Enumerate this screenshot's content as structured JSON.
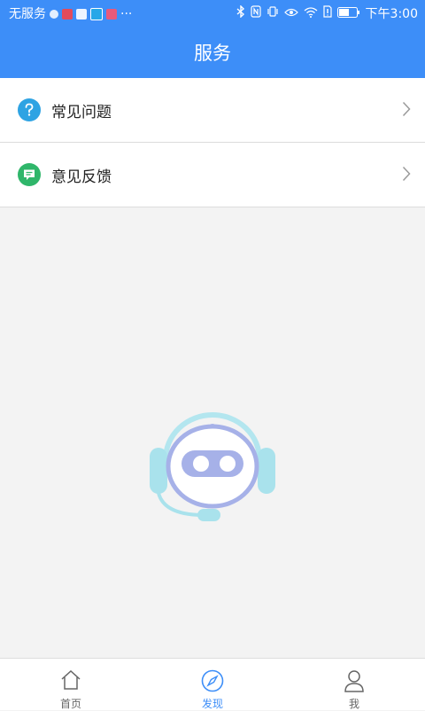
{
  "status_bar": {
    "carrier": "无服务",
    "more": "···",
    "time": "下午3:00"
  },
  "header": {
    "title": "服务"
  },
  "list": [
    {
      "label": "常见问题",
      "icon": "help-circle-icon",
      "color": "#2ea3e3"
    },
    {
      "label": "意见反馈",
      "icon": "feedback-icon",
      "color": "#2fb66a"
    }
  ],
  "tabs": [
    {
      "label": "首页",
      "icon": "home-icon",
      "active": false
    },
    {
      "label": "发现",
      "icon": "compass-icon",
      "active": true
    },
    {
      "label": "我",
      "icon": "person-icon",
      "active": false
    }
  ],
  "colors": {
    "header": "#3d8ef8",
    "active_tab": "#3d8ef8",
    "background": "#f3f3f3"
  }
}
